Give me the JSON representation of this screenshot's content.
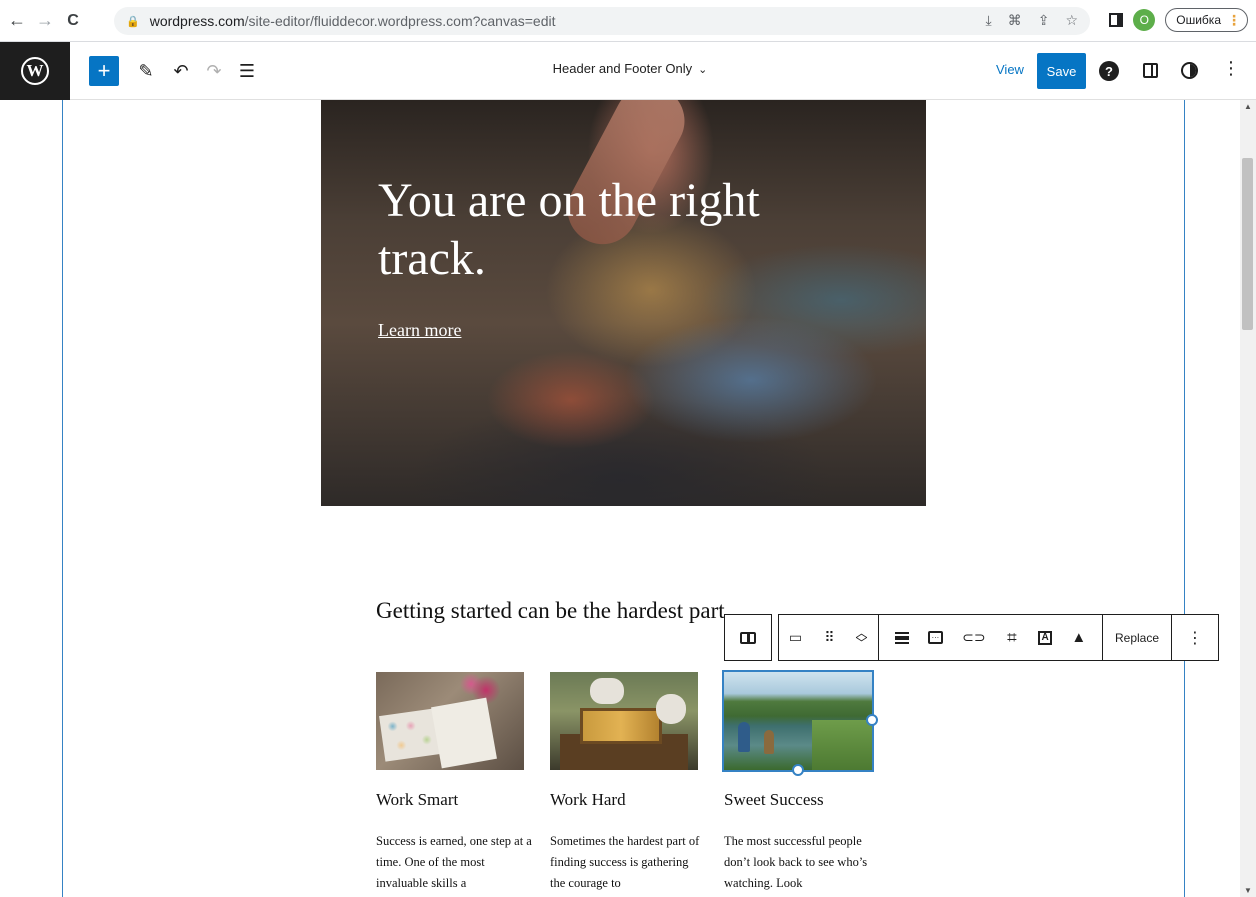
{
  "browser": {
    "url_host": "wordpress.com",
    "url_path": "/site-editor/fluiddecor.wordpress.com?canvas=edit",
    "profile_initial": "O",
    "error_chip_label": "Ошибка"
  },
  "editor": {
    "template_title": "Header and Footer Only",
    "view_label": "View",
    "save_label": "Save",
    "accent_color": "#0675c4"
  },
  "hero": {
    "title": "You are on the right track.",
    "link_text": "Learn more"
  },
  "section": {
    "heading": "Getting started can be the hardest part."
  },
  "cards": [
    {
      "title": "Work Smart",
      "text": "Success is earned, one step at a time. One of the most invaluable skills a"
    },
    {
      "title": "Work Hard",
      "text": "Sometimes the hardest part of finding success is gathering the courage to"
    },
    {
      "title": "Sweet Success",
      "text": "The most successful people don’t look back to see who’s watching. Look"
    }
  ],
  "block_toolbar": {
    "replace_label": "Replace"
  },
  "icons": {
    "logo": "wordpress-logo-icon",
    "add": "plus-icon",
    "edit": "pencil-icon",
    "undo": "undo-icon",
    "redo": "redo-icon",
    "list_view": "list-view-icon",
    "help": "help-icon",
    "settings": "sidebar-toggle-icon",
    "styles": "styles-icon",
    "more": "more-vertical-icon"
  }
}
